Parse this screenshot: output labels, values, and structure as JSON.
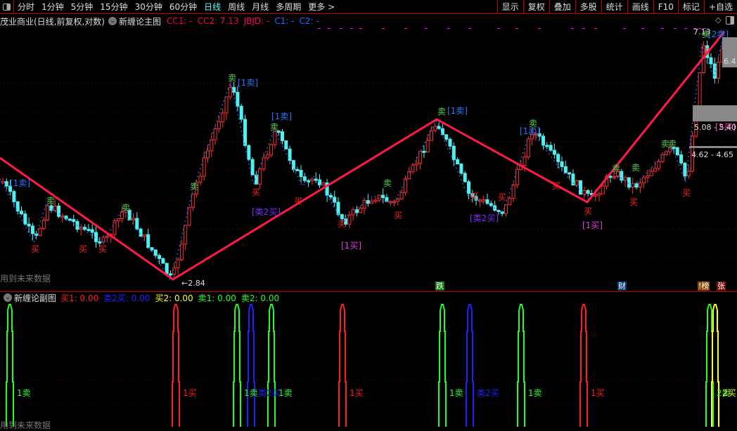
{
  "toolbar": {
    "periods": [
      "分时",
      "1分钟",
      "5分钟",
      "15分钟",
      "30分钟",
      "60分钟",
      "日线",
      "周线",
      "月线",
      "多周期",
      "更多 >"
    ],
    "active_period": "日线",
    "right_buttons": [
      "显示",
      "复权",
      "叠加",
      "多股",
      "统计",
      "画线",
      "F10",
      "标记",
      "+自选"
    ]
  },
  "info": {
    "stock": "茂业商业(日线,前复权,对数)",
    "indicator": "新缠论主图",
    "fields": [
      {
        "text": "CC1: -",
        "color": "#ff0033"
      },
      {
        "text": "CC2: 7.13",
        "color": "#ff0033"
      },
      {
        "text": "JBJD: -",
        "color": "#ff0066"
      },
      {
        "text": "C1: -",
        "color": "#1e6cff"
      },
      {
        "text": "C2: -",
        "color": "#1e6cff"
      }
    ]
  },
  "main": {
    "signals": [
      {
        "text": "[1卖]",
        "color": "#1e7bff"
      },
      {
        "text": "卖",
        "color": "#4ad04a"
      },
      {
        "text": "买",
        "color": "#ff2020"
      },
      {
        "text": "卖",
        "color": "#4ad04a"
      },
      {
        "text": "买",
        "color": "#ff2020"
      },
      {
        "text": "买",
        "color": "#ff2020"
      },
      {
        "text": "卖",
        "color": "#4ad04a"
      },
      {
        "text": "买",
        "color": "#ff2020"
      },
      {
        "text": "卖",
        "color": "#4ad04a"
      },
      {
        "text": "[1卖]",
        "color": "#1e7bff"
      },
      {
        "text": "卖",
        "color": "#4ad04a"
      },
      {
        "text": "[1卖]",
        "color": "#1e7bff"
      },
      {
        "text": "卖",
        "color": "#4ad04a"
      },
      {
        "text": "买",
        "color": "#ff2020"
      },
      {
        "text": "[类2买]",
        "color": "#7b2bff"
      },
      {
        "text": "买",
        "color": "#ff2020"
      },
      {
        "text": "买",
        "color": "#ff2020"
      },
      {
        "text": "[1买]",
        "color": "#e040e0"
      },
      {
        "text": "卖",
        "color": "#4ad04a"
      },
      {
        "text": "买",
        "color": "#ff2020"
      },
      {
        "text": "卖",
        "color": "#4ad04a"
      },
      {
        "text": "[1卖]",
        "color": "#1e7bff"
      },
      {
        "text": "买",
        "color": "#ff2020"
      },
      {
        "text": "[类2买]",
        "color": "#7b2bff"
      },
      {
        "text": "买",
        "color": "#ff2020"
      },
      {
        "text": "卖",
        "color": "#4ad04a"
      },
      {
        "text": "[1卖]",
        "color": "#1e7bff"
      },
      {
        "text": "买",
        "color": "#ff2020"
      },
      {
        "text": "买",
        "color": "#ff2020"
      },
      {
        "text": "[1买]",
        "color": "#e040e0"
      },
      {
        "text": "卖",
        "color": "#4ad04a"
      },
      {
        "text": "卖",
        "color": "#4ad04a"
      },
      {
        "text": "买",
        "color": "#ff2020"
      },
      {
        "text": "卖",
        "color": "#4ad04a"
      },
      {
        "text": "买",
        "color": "#ff2020"
      },
      {
        "text": "卖",
        "color": "#4ad04a"
      },
      {
        "text": "[2卖]",
        "color": "#1e7bff"
      },
      {
        "text": "[2买]",
        "color": "#ff40c0"
      }
    ],
    "low_label": "2.84",
    "high_label": "7.13",
    "price_partial": "6.4",
    "range1": "5.08 - 5.40",
    "range2": "4.62 - 4.65",
    "future_note": "用到未来数据",
    "tags": [
      {
        "text": "跌",
        "bg": "#0a7a0a"
      },
      {
        "text": "财",
        "bg": "#0a3a7a"
      },
      {
        "text": "!榜",
        "bg": "#8a4a0a"
      },
      {
        "text": "张",
        "bg": "#7a0a0a"
      }
    ],
    "colors": {
      "up": "#ff3030",
      "down": "#50f0f0",
      "trend": "#ff1a4a",
      "zigzag": "#1e6cff",
      "grid": "#8a0000"
    }
  },
  "sub": {
    "title": "新缠论副图",
    "fields": [
      {
        "text": "买1: 0.00",
        "color": "#ff2020"
      },
      {
        "text": "类2买: 0.00",
        "color": "#2020ff"
      },
      {
        "text": "买2: 0.00",
        "color": "#ffff20"
      },
      {
        "text": "卖1: 0.00",
        "color": "#20ff20"
      },
      {
        "text": "卖2: 0.00",
        "color": "#20ff20"
      }
    ],
    "spikes": [
      {
        "label": "1卖",
        "color": "#20ff20"
      },
      {
        "label": "1买",
        "color": "#ff2020"
      },
      {
        "label": "1卖",
        "color": "#20ff20"
      },
      {
        "label": "类2买",
        "color": "#2020ff"
      },
      {
        "label": "1卖",
        "color": "#20ff20"
      },
      {
        "label": "1买",
        "color": "#ff2020"
      },
      {
        "label": "1卖",
        "color": "#20ff20"
      },
      {
        "label": "类2买",
        "color": "#2020ff"
      },
      {
        "label": "1卖",
        "color": "#20ff20"
      },
      {
        "label": "1买",
        "color": "#ff2020"
      },
      {
        "label": "2卖",
        "color": "#20ff20"
      },
      {
        "label": "2买",
        "color": "#ffff20"
      }
    ],
    "future_note": "用到未来数据"
  }
}
